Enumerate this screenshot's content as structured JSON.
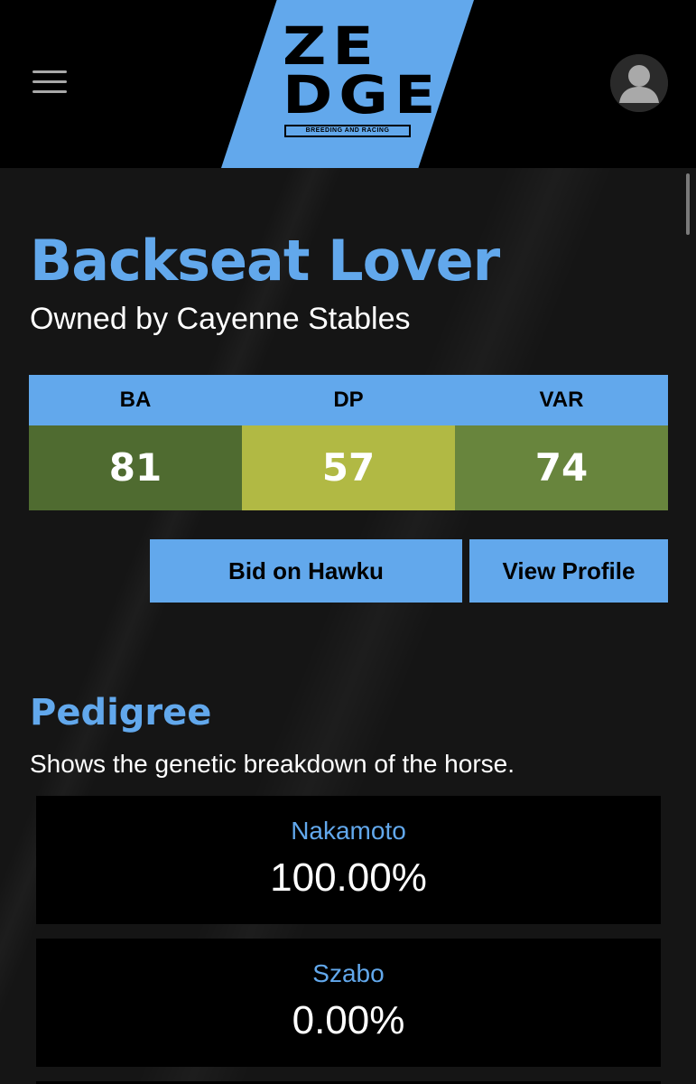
{
  "header": {
    "logo": {
      "line1": "ZE",
      "line2": "DGE",
      "tagline": "BREEDING AND RACING"
    },
    "menu_icon": "hamburger-menu-icon",
    "avatar_icon": "user-avatar-icon"
  },
  "horse": {
    "name": "Backseat Lover",
    "owner_text": "Owned by Cayenne Stables"
  },
  "stats": {
    "headers": [
      "BA",
      "DP",
      "VAR"
    ],
    "values": [
      "81",
      "57",
      "74"
    ],
    "colors": [
      "#4f6b30",
      "#b1b944",
      "#68853d"
    ]
  },
  "actions": {
    "bid_label": "Bid on Hawku",
    "profile_label": "View Profile"
  },
  "pedigree": {
    "title": "Pedigree",
    "description": "Shows the genetic breakdown of the horse.",
    "entries": [
      {
        "name": "Nakamoto",
        "percent": "100.00%"
      },
      {
        "name": "Szabo",
        "percent": "0.00%"
      }
    ]
  },
  "colors": {
    "accent": "#62a8ec",
    "background": "#151515",
    "header": "#000000"
  }
}
